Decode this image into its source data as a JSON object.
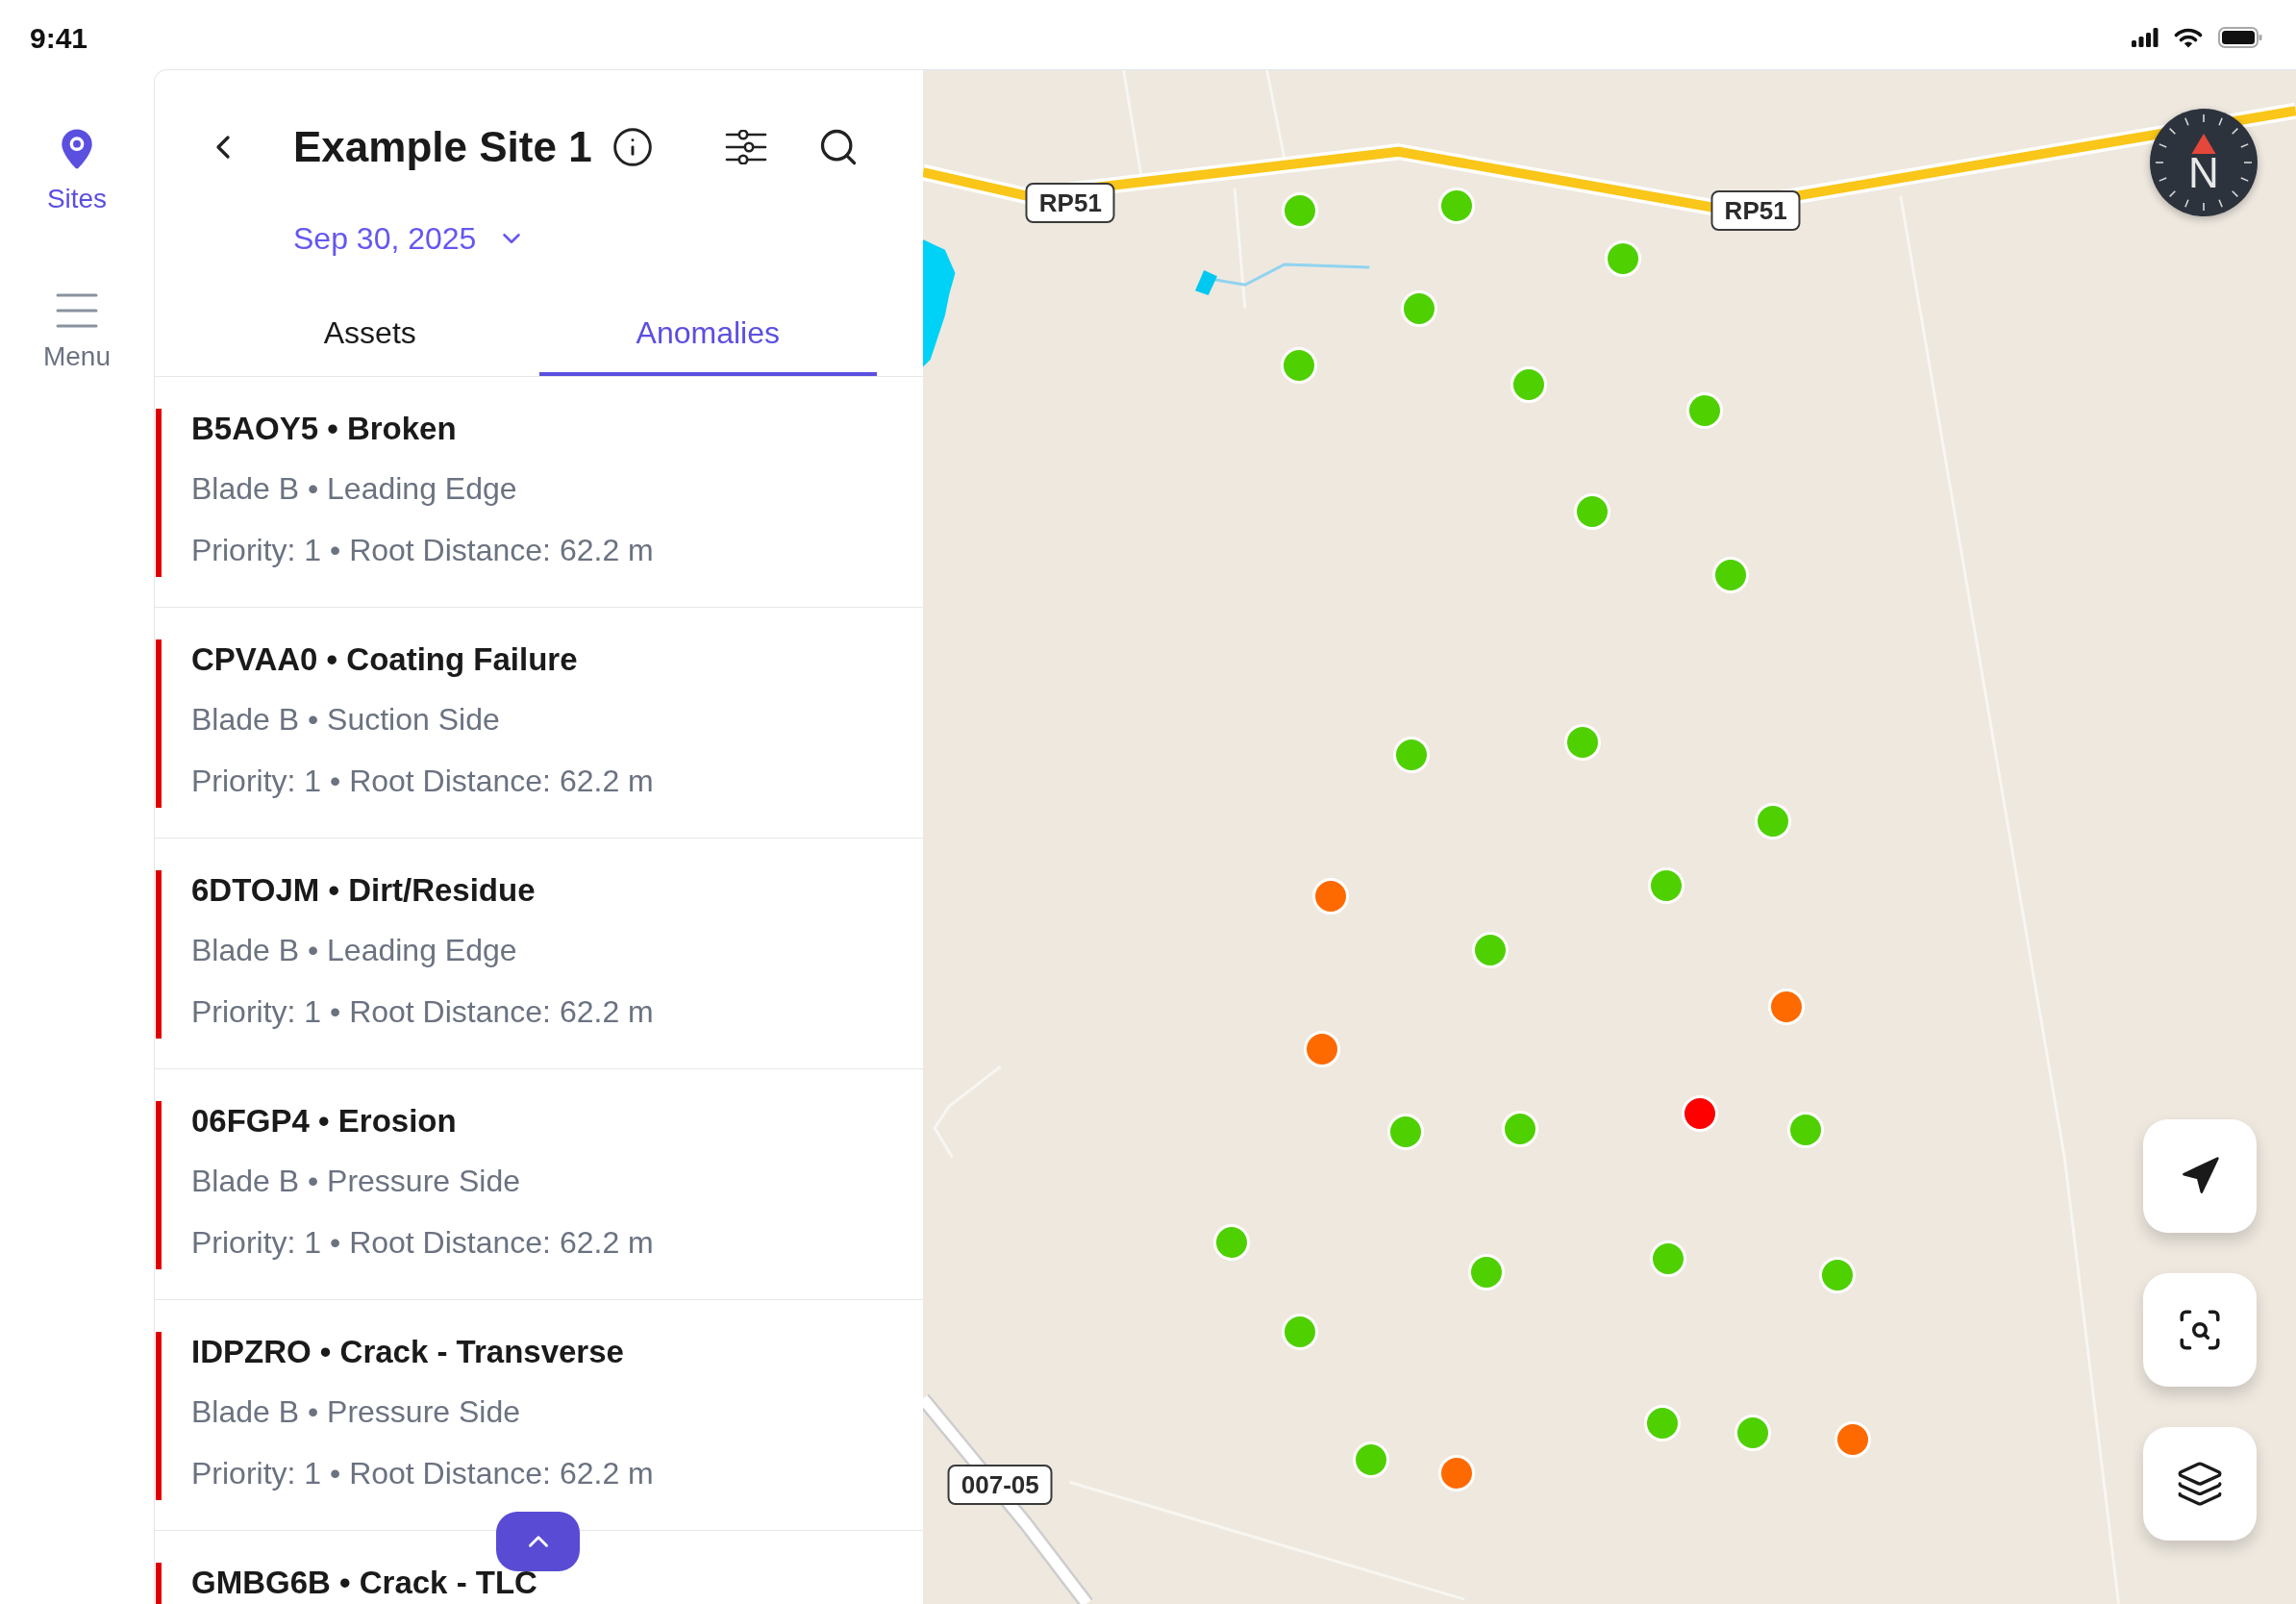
{
  "status_bar": {
    "time": "9:41"
  },
  "nav_rail": {
    "items": [
      {
        "label": "Sites",
        "selected": true
      },
      {
        "label": "Menu",
        "selected": false
      }
    ]
  },
  "panel": {
    "title": "Example Site 1",
    "date": "Sep 30, 2025",
    "tabs": [
      {
        "label": "Assets",
        "selected": false
      },
      {
        "label": "Anomalies",
        "selected": true
      }
    ],
    "anomalies": [
      {
        "title": "B5AOY5 • Broken",
        "detail": "Blade B • Leading Edge",
        "meta": "Priority: 1 • Root Distance: 62.2 m"
      },
      {
        "title": "CPVAA0 • Coating Failure",
        "detail": "Blade B • Suction Side",
        "meta": "Priority: 1 • Root Distance: 62.2 m"
      },
      {
        "title": "6DTOJM • Dirt/Residue",
        "detail": "Blade B • Leading Edge",
        "meta": "Priority: 1 • Root Distance: 62.2 m"
      },
      {
        "title": "06FGP4 • Erosion",
        "detail": "Blade B • Pressure Side",
        "meta": "Priority: 1 • Root Distance: 62.2 m"
      },
      {
        "title": "IDPZRO • Crack - Transverse",
        "detail": "Blade B • Pressure Side",
        "meta": "Priority: 1 • Root Distance: 62.2 m"
      },
      {
        "title": "GMBG6B • Crack - TLC"
      }
    ]
  },
  "map": {
    "compass": {
      "label": "N"
    },
    "road_labels": [
      "RP51",
      "RP51",
      "007-05"
    ],
    "markers": [
      {
        "color": "#4fd000"
      },
      {
        "color": "#4fd000"
      },
      {
        "color": "#4fd000"
      },
      {
        "color": "#4fd000"
      },
      {
        "color": "#4fd000"
      },
      {
        "color": "#4fd000"
      },
      {
        "color": "#4fd000"
      },
      {
        "color": "#4fd000"
      },
      {
        "color": "#4fd000"
      },
      {
        "color": "#4fd000"
      },
      {
        "color": "#4fd000"
      },
      {
        "color": "#4fd000"
      },
      {
        "color": "#4fd000"
      },
      {
        "color": "#ff6a00"
      },
      {
        "color": "#4fd000"
      },
      {
        "color": "#ff6a00"
      },
      {
        "color": "#ff6a00"
      },
      {
        "color": "#ff0000"
      },
      {
        "color": "#4fd000"
      },
      {
        "color": "#4fd000"
      },
      {
        "color": "#4fd000"
      },
      {
        "color": "#4fd000"
      },
      {
        "color": "#4fd000"
      },
      {
        "color": "#4fd000"
      },
      {
        "color": "#4fd000"
      },
      {
        "color": "#4fd000"
      },
      {
        "color": "#4fd000"
      },
      {
        "color": "#4fd000"
      },
      {
        "color": "#ff6a00"
      },
      {
        "color": "#4fd000"
      },
      {
        "color": "#ff6a00"
      }
    ]
  }
}
